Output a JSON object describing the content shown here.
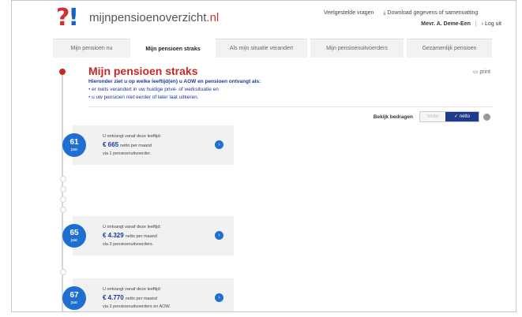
{
  "header": {
    "logo_text": "mijnpensioenoverzicht",
    "logo_tld": ".nl",
    "links": [
      "Veelgestelde vragen",
      "⤓ Download gegevens of samenvatting"
    ],
    "user": "Mevr. A. Deme-Een",
    "logout": "› Log uit"
  },
  "tabs": [
    {
      "label": "Mijn pensioen nu"
    },
    {
      "label": "Mijn pensioen straks"
    },
    {
      "label": "Als mijn situatie verandert"
    },
    {
      "label": "Mijn pensioenuitvoerders"
    },
    {
      "label": "Gezamenlijk pensioen"
    }
  ],
  "page": {
    "title": "Mijn pensioen straks",
    "print": "print",
    "intro_heading": "Hieronder ziet u op welke leeftijd(en) u AOW en pensioen ontvangt als:",
    "intro_items": [
      "er niets verandert in uw huidige privé- of werksituatie en",
      "u uw pensioen niet eerder of later laat uitkeren."
    ],
    "toggle_label": "Bekijk bedragen",
    "toggle_off": "bruto",
    "toggle_on": "✓ netto"
  },
  "cards": [
    {
      "age": "61",
      "age_unit": "jaar",
      "line1": "U ontvangt vanaf deze leeftijd:",
      "amount": "€ 665",
      "amount_unit": "netto per maand",
      "line3": "via 1 pensioenuitvoerder."
    },
    {
      "age": "65",
      "age_unit": "jaar",
      "line1": "U ontvangt vanaf deze leeftijd:",
      "amount": "€ 4.329",
      "amount_unit": "netto per maand",
      "line3": "via 3 pensioenuitvoerders."
    },
    {
      "age": "67",
      "age_unit": "jaar",
      "line1": "U ontvangt vanaf deze leeftijd:",
      "amount": "€ 4.770",
      "amount_unit": "netto per maand",
      "line3": "via 3 pensioenuitvoerders en AOW."
    }
  ],
  "colors": {
    "accent_red": "#c62828",
    "accent_blue": "#1e6fd0",
    "dark_blue": "#1e3a8a"
  }
}
